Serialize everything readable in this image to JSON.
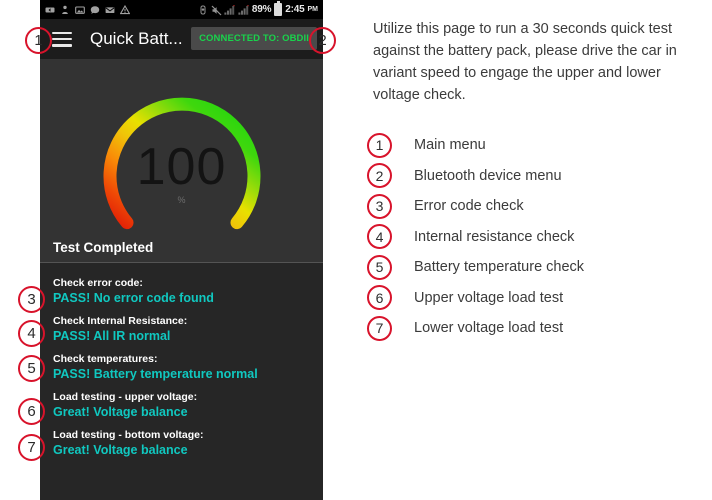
{
  "status_bar": {
    "icons": [
      "back-icon",
      "person-icon",
      "image-icon",
      "chat-icon",
      "mail-icon",
      "warning-icon",
      "usb-icon",
      "mute-icon",
      "signal-icon-1",
      "signal-icon-2"
    ],
    "battery_percent": "89%",
    "battery_icon": "battery-full-icon",
    "time": "2:45",
    "time_suffix": "PM"
  },
  "action_bar": {
    "menu_icon": "hamburger-menu-icon",
    "title": "Quick Batt...",
    "connection_badge": "CONNECTED TO: OBDII"
  },
  "gauge": {
    "value": "100",
    "unit": "%",
    "status": "Test Completed",
    "arc_start_color": "#e01a06",
    "arc_mid_color": "#e8e000",
    "arc_end_color": "#17d611",
    "value_color": "#131313"
  },
  "results": [
    {
      "label": "Check error code:",
      "value": "PASS! No error code found",
      "callout": "3"
    },
    {
      "label": "Check Internal Resistance:",
      "value": "PASS! All IR normal",
      "callout": "4"
    },
    {
      "label": "Check temperatures:",
      "value": "PASS! Battery temperature normal",
      "callout": "5"
    },
    {
      "label": "Load testing - upper voltage:",
      "value": "Great! Voltage balance",
      "callout": "6"
    },
    {
      "label": "Load testing - bottom voltage:",
      "value": "Great! Voltage balance",
      "callout": "7"
    }
  ],
  "callouts_on_screenshot": [
    {
      "number": "1",
      "target": "main-menu"
    },
    {
      "number": "2",
      "target": "bluetooth-device-menu"
    }
  ],
  "right_panel": {
    "intro": "Utilize this page to run a 30 seconds quick test against the battery pack, please drive the car in variant speed to engage the upper and lower voltage check.",
    "legend": [
      {
        "number": "1",
        "label": "Main menu"
      },
      {
        "number": "2",
        "label": "Bluetooth device menu"
      },
      {
        "number": "3",
        "label": "Error code check"
      },
      {
        "number": "4",
        "label": "Internal resistance check"
      },
      {
        "number": "5",
        "label": "Battery temperature check"
      },
      {
        "number": "6",
        "label": "Upper voltage load test"
      },
      {
        "number": "7",
        "label": "Lower voltage load test"
      }
    ]
  },
  "colors": {
    "callout_ring": "#d8132b",
    "result_value": "#10c8c0",
    "connected_green": "#19d34c",
    "panel_bg": "#262626",
    "card_bg": "#333333"
  }
}
